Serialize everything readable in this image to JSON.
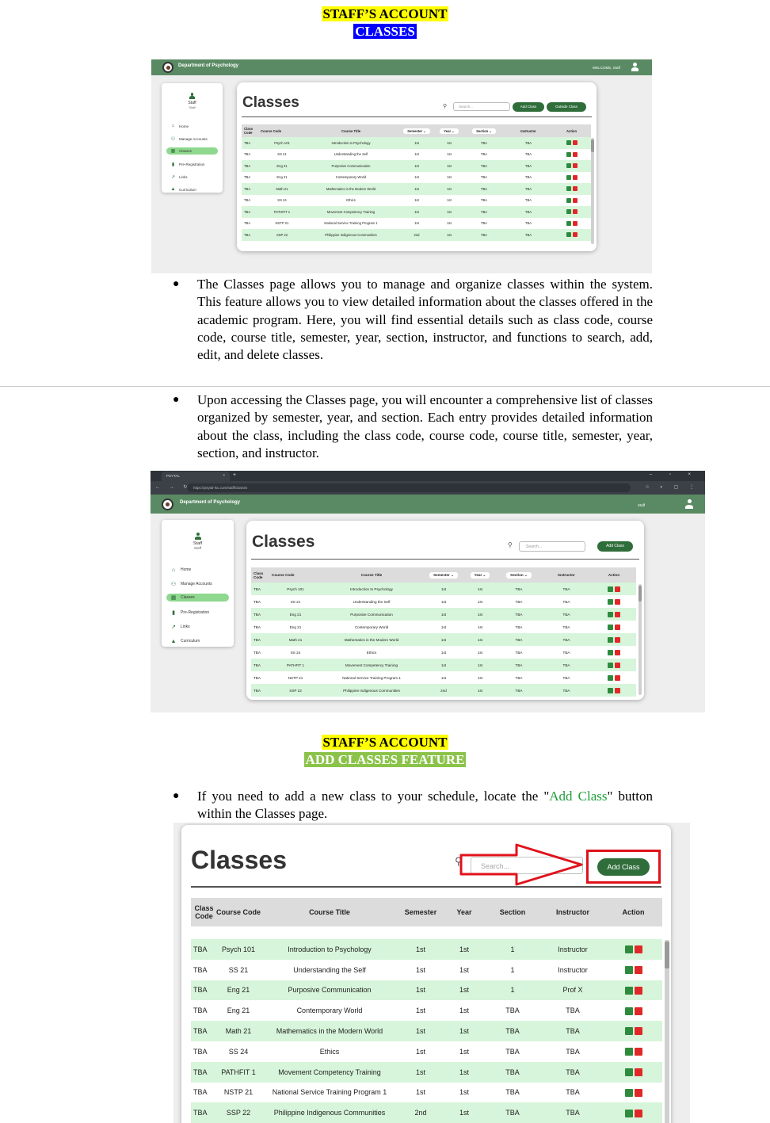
{
  "headings": {
    "h1_line1": "STAFF’S ACCOUNT",
    "h1_line2": "CLASSES",
    "h2_line1": "STAFF’S ACCOUNT",
    "h2_line2": "ADD CLASSES FEATURE"
  },
  "paragraphs": {
    "p1": "The Classes page allows you to manage and organize classes within the system. This feature allows you to view detailed information about the classes offered in the academic program. Here, you will find essential details such as class code, course code, course title, semester, year, section, instructor, and functions to search, add, edit, and delete classes.",
    "p2": "Upon accessing the Classes page, you will encounter a comprehensive list of classes organized by semester, year, and section. Each entry provides detailed information about the class, including the class code, course code, course title, semester, year, section, and instructor.",
    "p3_before": "If you need to add a new class to your schedule, locate the \"",
    "p3_highlight": "Add Class",
    "p3_after": "\" button within the Classes page."
  },
  "colors": {
    "header_green": "#5a8a63",
    "button_green": "#2f6e3a",
    "row_green": "#d7f5da",
    "highlight_red": "#e0121b"
  },
  "app": {
    "department": "Department of Psychology",
    "welcome": "WELCOME, Staff",
    "staff_label": "Staff",
    "user_name": "Staff",
    "user_role": "Staff",
    "browser_tab": "PSYTAL",
    "browser_url": "https://psytal-lsu.com/staff/classes",
    "nav": [
      {
        "label": "Home",
        "icon": "home-icon"
      },
      {
        "label": "Manage Accounts",
        "icon": "users-icon"
      },
      {
        "label": "Classes",
        "icon": "classes-icon"
      },
      {
        "label": "Pre-Registration",
        "icon": "document-icon"
      },
      {
        "label": "Links",
        "icon": "external-link-icon"
      },
      {
        "label": "Curriculum",
        "icon": "graduation-cap-icon"
      }
    ],
    "page_title": "Classes",
    "search_placeholder": "Search...",
    "add_class_label": "Add Class",
    "outside_class_label": "Outside Class",
    "columns": {
      "class_code": "Class Code",
      "course_code": "Course Code",
      "course_title": "Course Title",
      "semester": "Semester",
      "year": "Year",
      "section": "Section",
      "instructor": "Instructor",
      "action": "Action"
    },
    "rows": [
      {
        "class_code": "TBA",
        "course_code": "Psych 101",
        "course_title": "Introduction to Psychology",
        "semester": "1st",
        "year": "1st",
        "section": "TBA",
        "instructor": "TBA"
      },
      {
        "class_code": "TBA",
        "course_code": "SS 21",
        "course_title": "Understanding the Self",
        "semester": "1st",
        "year": "1st",
        "section": "TBA",
        "instructor": "TBA"
      },
      {
        "class_code": "TBA",
        "course_code": "Eng 21",
        "course_title": "Purposive Communication",
        "semester": "1st",
        "year": "1st",
        "section": "TBA",
        "instructor": "TBA"
      },
      {
        "class_code": "TBA",
        "course_code": "Eng 21",
        "course_title": "Contemporary World",
        "semester": "1st",
        "year": "1st",
        "section": "TBA",
        "instructor": "TBA"
      },
      {
        "class_code": "TBA",
        "course_code": "Math 21",
        "course_title": "Mathematics in the Modern World",
        "semester": "1st",
        "year": "1st",
        "section": "TBA",
        "instructor": "TBA"
      },
      {
        "class_code": "TBA",
        "course_code": "SS 24",
        "course_title": "Ethics",
        "semester": "1st",
        "year": "1st",
        "section": "TBA",
        "instructor": "TBA"
      },
      {
        "class_code": "TBA",
        "course_code": "PATHFIT 1",
        "course_title": "Movement Competency Training",
        "semester": "1st",
        "year": "1st",
        "section": "TBA",
        "instructor": "TBA"
      },
      {
        "class_code": "TBA",
        "course_code": "NSTP 21",
        "course_title": "National Service Training Program 1",
        "semester": "1st",
        "year": "1st",
        "section": "TBA",
        "instructor": "TBA"
      },
      {
        "class_code": "TBA",
        "course_code": "SSP 22",
        "course_title": "Philippine Indigenous Communities",
        "semester": "2nd",
        "year": "1st",
        "section": "TBA",
        "instructor": "TBA"
      }
    ],
    "rows_zoom": [
      {
        "class_code": "TBA",
        "course_code": "Psych 101",
        "course_title": "Introduction to Psychology",
        "semester": "1st",
        "year": "1st",
        "section": "1",
        "instructor": "Instructor"
      },
      {
        "class_code": "TBA",
        "course_code": "SS 21",
        "course_title": "Understanding the Self",
        "semester": "1st",
        "year": "1st",
        "section": "1",
        "instructor": "Instructor"
      },
      {
        "class_code": "TBA",
        "course_code": "Eng 21",
        "course_title": "Purposive Communication",
        "semester": "1st",
        "year": "1st",
        "section": "1",
        "instructor": "Prof X"
      },
      {
        "class_code": "TBA",
        "course_code": "Eng 21",
        "course_title": "Contemporary World",
        "semester": "1st",
        "year": "1st",
        "section": "TBA",
        "instructor": "TBA"
      },
      {
        "class_code": "TBA",
        "course_code": "Math 21",
        "course_title": "Mathematics in the Modern World",
        "semester": "1st",
        "year": "1st",
        "section": "TBA",
        "instructor": "TBA"
      },
      {
        "class_code": "TBA",
        "course_code": "SS 24",
        "course_title": "Ethics",
        "semester": "1st",
        "year": "1st",
        "section": "TBA",
        "instructor": "TBA"
      },
      {
        "class_code": "TBA",
        "course_code": "PATHFIT 1",
        "course_title": "Movement Competency Training",
        "semester": "1st",
        "year": "1st",
        "section": "TBA",
        "instructor": "TBA"
      },
      {
        "class_code": "TBA",
        "course_code": "NSTP 21",
        "course_title": "National Service Training Program 1",
        "semester": "1st",
        "year": "1st",
        "section": "TBA",
        "instructor": "TBA"
      },
      {
        "class_code": "TBA",
        "course_code": "SSP 22",
        "course_title": "Philippine Indigenous Communities",
        "semester": "2nd",
        "year": "1st",
        "section": "TBA",
        "instructor": "TBA"
      }
    ]
  }
}
